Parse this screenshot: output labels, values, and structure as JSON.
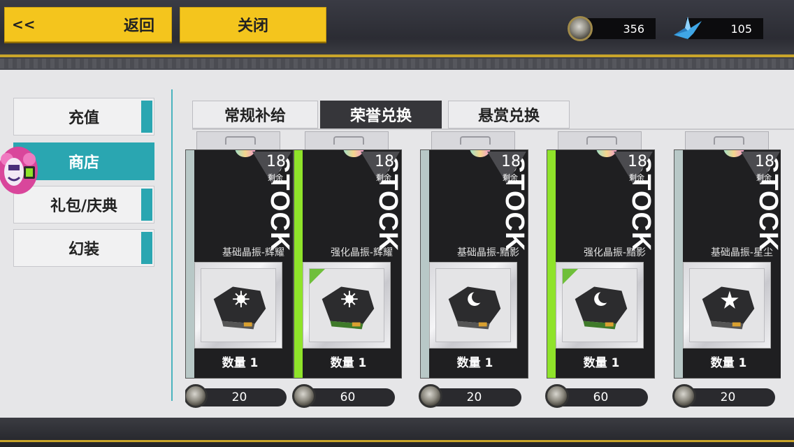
{
  "header": {
    "back_arrow": "<<",
    "back_label": "返回",
    "close_label": "关闭",
    "coin_amount": "356",
    "crane_amount": "105"
  },
  "sidebar": {
    "items": [
      {
        "label": "充值"
      },
      {
        "label": "商店"
      },
      {
        "label": "礼包/庆典"
      },
      {
        "label": "幻装"
      }
    ],
    "active_index": 1
  },
  "tabs": [
    {
      "label": "常规补给"
    },
    {
      "label": "荣誉兑换"
    },
    {
      "label": "悬赏兑换"
    }
  ],
  "active_tab": 1,
  "cards": [
    {
      "stock": "STOCK",
      "remain": "18",
      "remain_label": "剩余",
      "name": "基础晶振-辉耀",
      "qty": "数量 1",
      "price": "20",
      "icon": "sun-emblem-icon"
    },
    {
      "stock": "STOCK",
      "remain": "18",
      "remain_label": "剩余",
      "name": "强化晶振-辉耀",
      "qty": "数量 1",
      "price": "60",
      "icon": "sun-emblem-icon"
    },
    {
      "stock": "STOCK",
      "remain": "18",
      "remain_label": "剩余",
      "name": "基础晶振-黯影",
      "qty": "数量 1",
      "price": "20",
      "icon": "moon-emblem-icon"
    },
    {
      "stock": "STOCK",
      "remain": "18",
      "remain_label": "剩余",
      "name": "强化晶振-黯影",
      "qty": "数量 1",
      "price": "60",
      "icon": "moon-emblem-icon"
    },
    {
      "stock": "STOCK",
      "remain": "18",
      "remain_label": "剩余",
      "name": "基础晶振-星尘",
      "qty": "数量 1",
      "price": "20",
      "icon": "star-emblem-icon"
    }
  ],
  "colors": {
    "accent_yellow": "#f4c51d",
    "accent_teal": "#2aa6b1",
    "card_green": "#8fe32a"
  }
}
